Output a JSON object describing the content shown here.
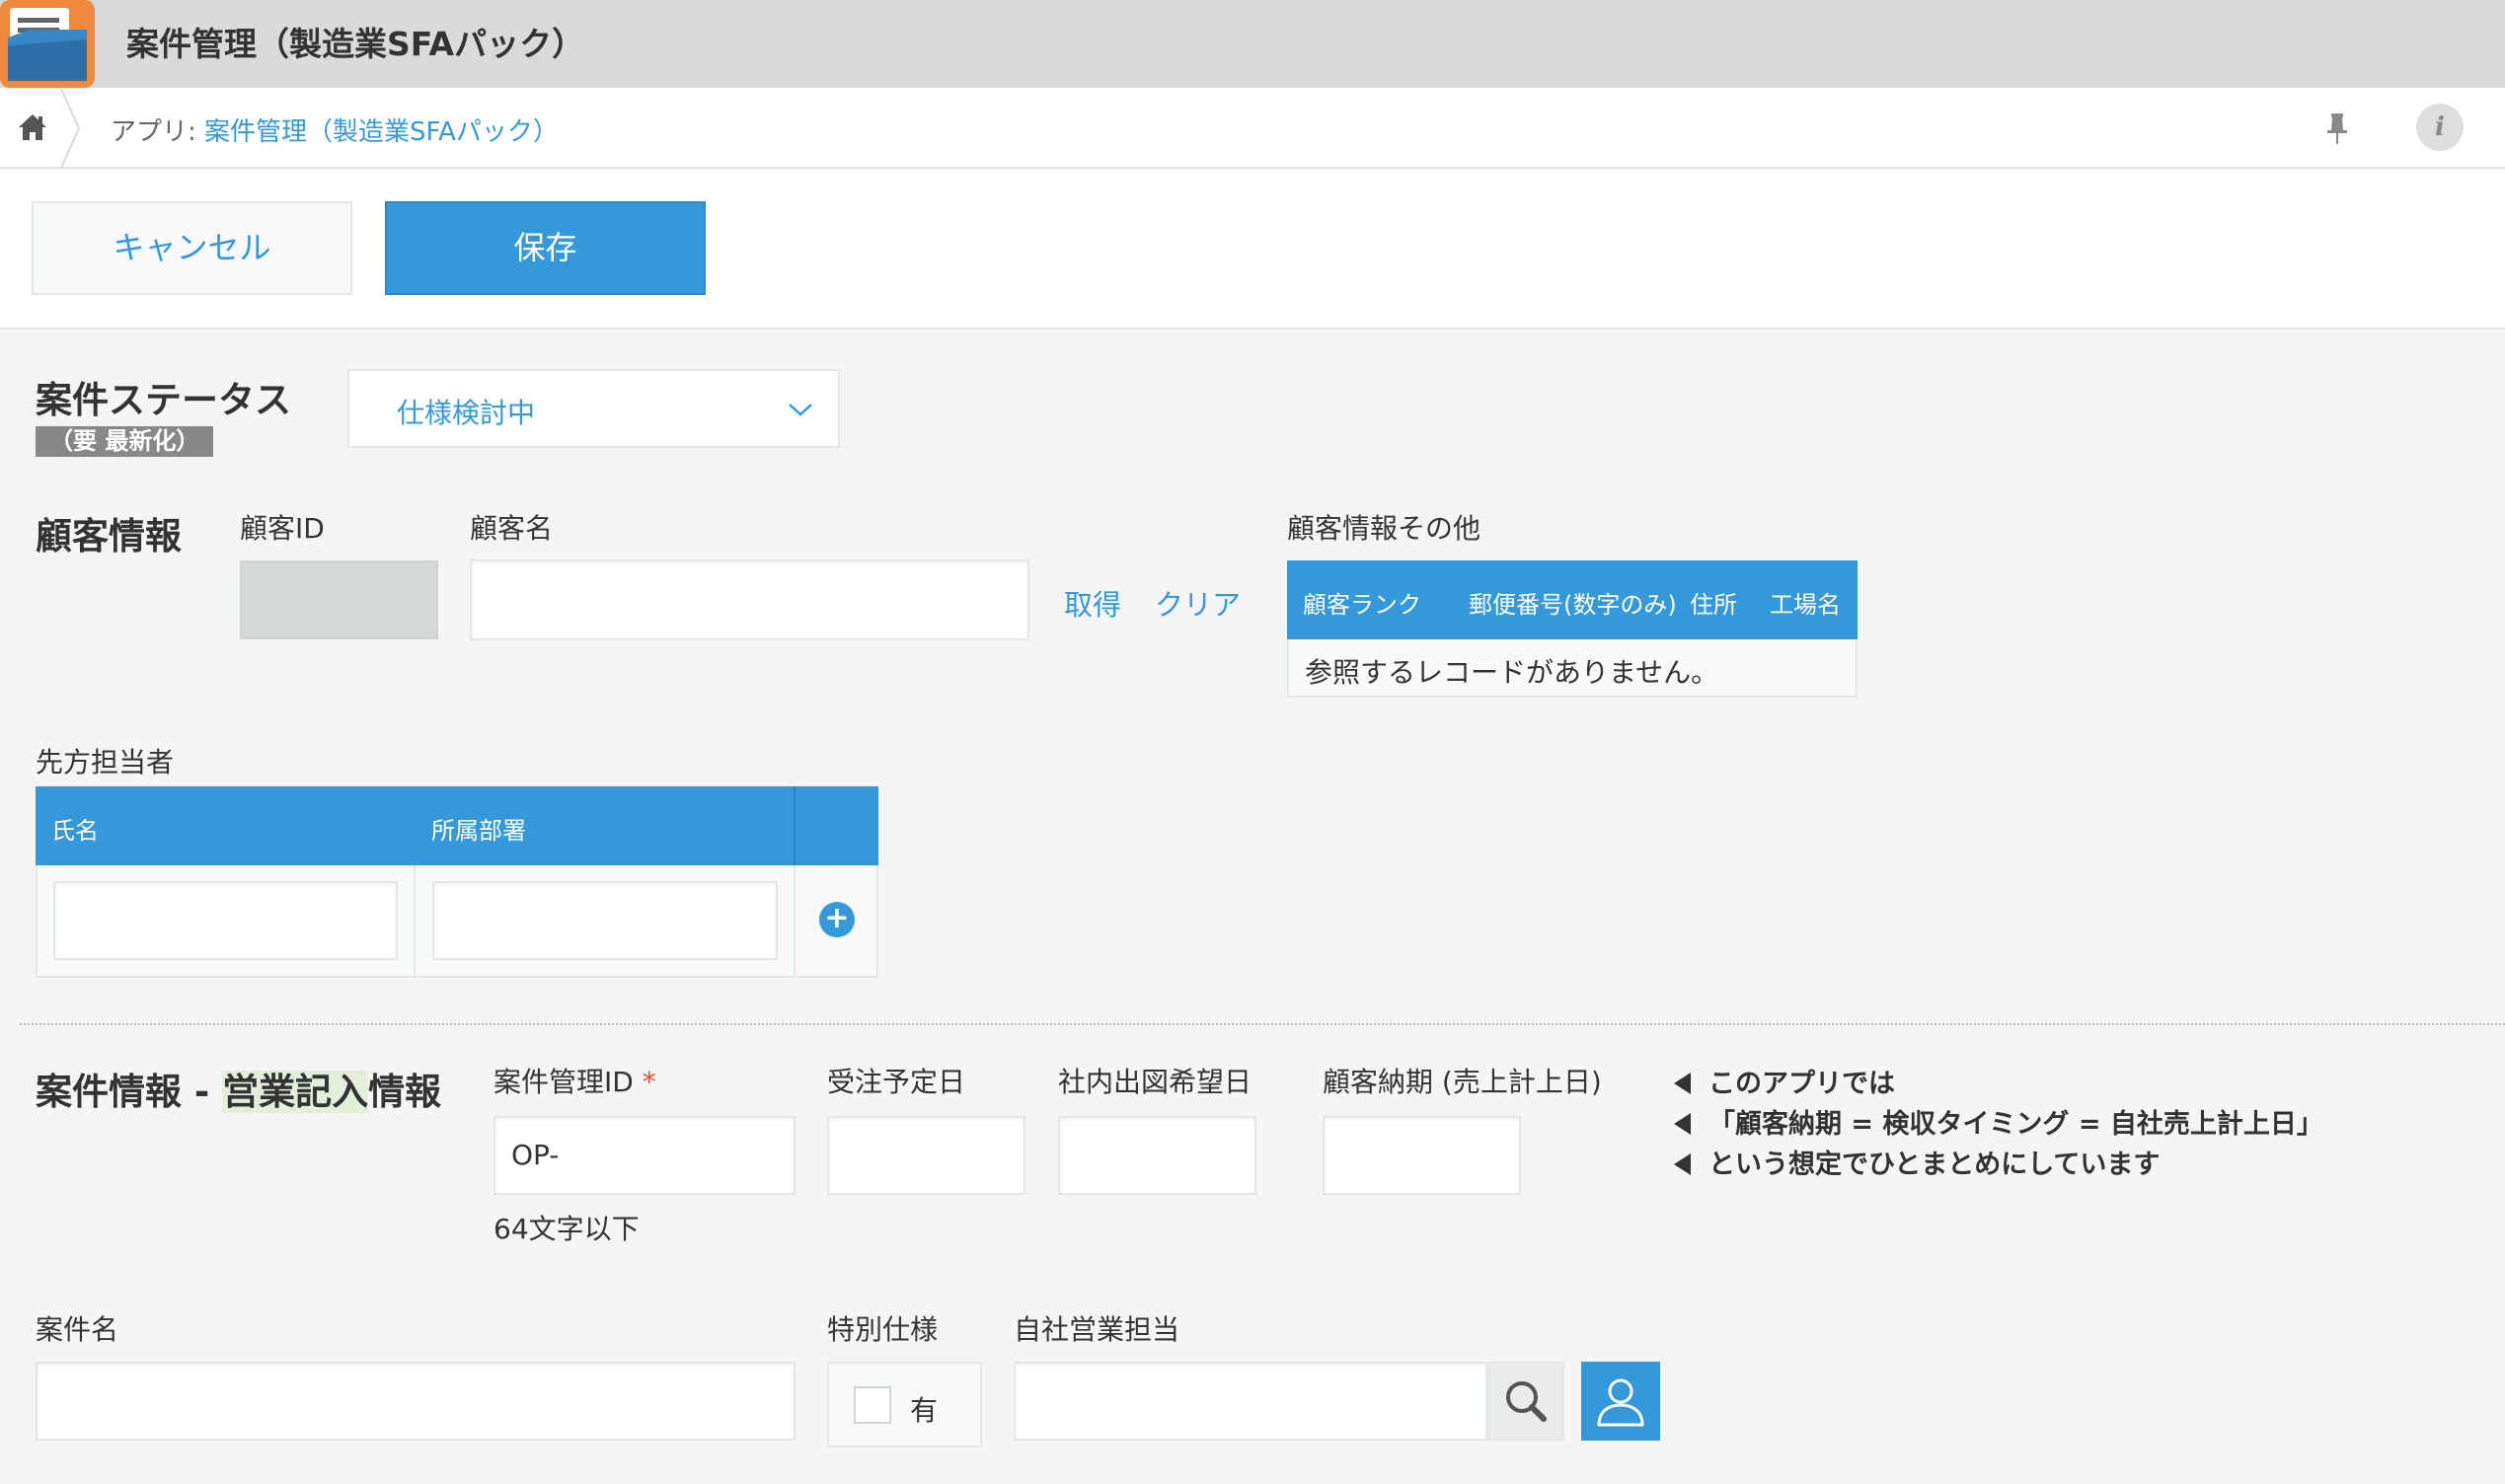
{
  "app": {
    "title": "案件管理（製造業SFAパック）"
  },
  "breadcrumb": {
    "prefix": "アプリ: ",
    "app_link": "案件管理（製造業SFAパック）"
  },
  "header_icons": {
    "home": "home-icon",
    "pin": "pin-icon",
    "info": "info-icon",
    "info_glyph": "i"
  },
  "toolbar": {
    "cancel_label": "キャンセル",
    "save_label": "保存"
  },
  "status": {
    "label": "案件ステータス",
    "badge": "（要 最新化）",
    "value": "仕様検討中"
  },
  "customer": {
    "section_label": "顧客情報",
    "id_label": "顧客ID",
    "id_value": "",
    "name_label": "顧客名",
    "name_value": "",
    "fetch_label": "取得",
    "clear_label": "クリア",
    "other_label": "顧客情報その他",
    "ref_columns": [
      "顧客ランク",
      "郵便番号(数字のみ)",
      "住所",
      "工場名"
    ],
    "ref_empty": "参照するレコードがありません。"
  },
  "contact": {
    "label": "先方担当者",
    "columns": [
      "氏名",
      "所属部署"
    ],
    "rows": [
      {
        "name": "",
        "dept": ""
      }
    ],
    "add_glyph": "+"
  },
  "deal": {
    "section_label_a": "案件情報 - ",
    "section_label_hl": "営業記入",
    "section_label_b": "情報",
    "id_label": "案件管理ID",
    "id_required_mark": "*",
    "id_value": "OP-",
    "id_hint": "64文字以下",
    "order_date_label": "受注予定日",
    "drawing_date_label": "社内出図希望日",
    "delivery_label": "顧客納期 (売上計上日)",
    "notes": [
      "このアプリでは",
      "「顧客納期 = 検収タイミング = 自社売上計上日」",
      "という想定でひとまとめにしています"
    ],
    "name_label": "案件名",
    "name_value": "",
    "special_label": "特別仕様",
    "special_option": "有",
    "special_checked": false,
    "sales_rep_label": "自社営業担当",
    "sales_rep_value": ""
  },
  "colors": {
    "accent": "#3498db",
    "title_bar": "#d8dadb",
    "badge": "#888888",
    "required": "#e74c3c",
    "highlight": "#e3efd9"
  }
}
